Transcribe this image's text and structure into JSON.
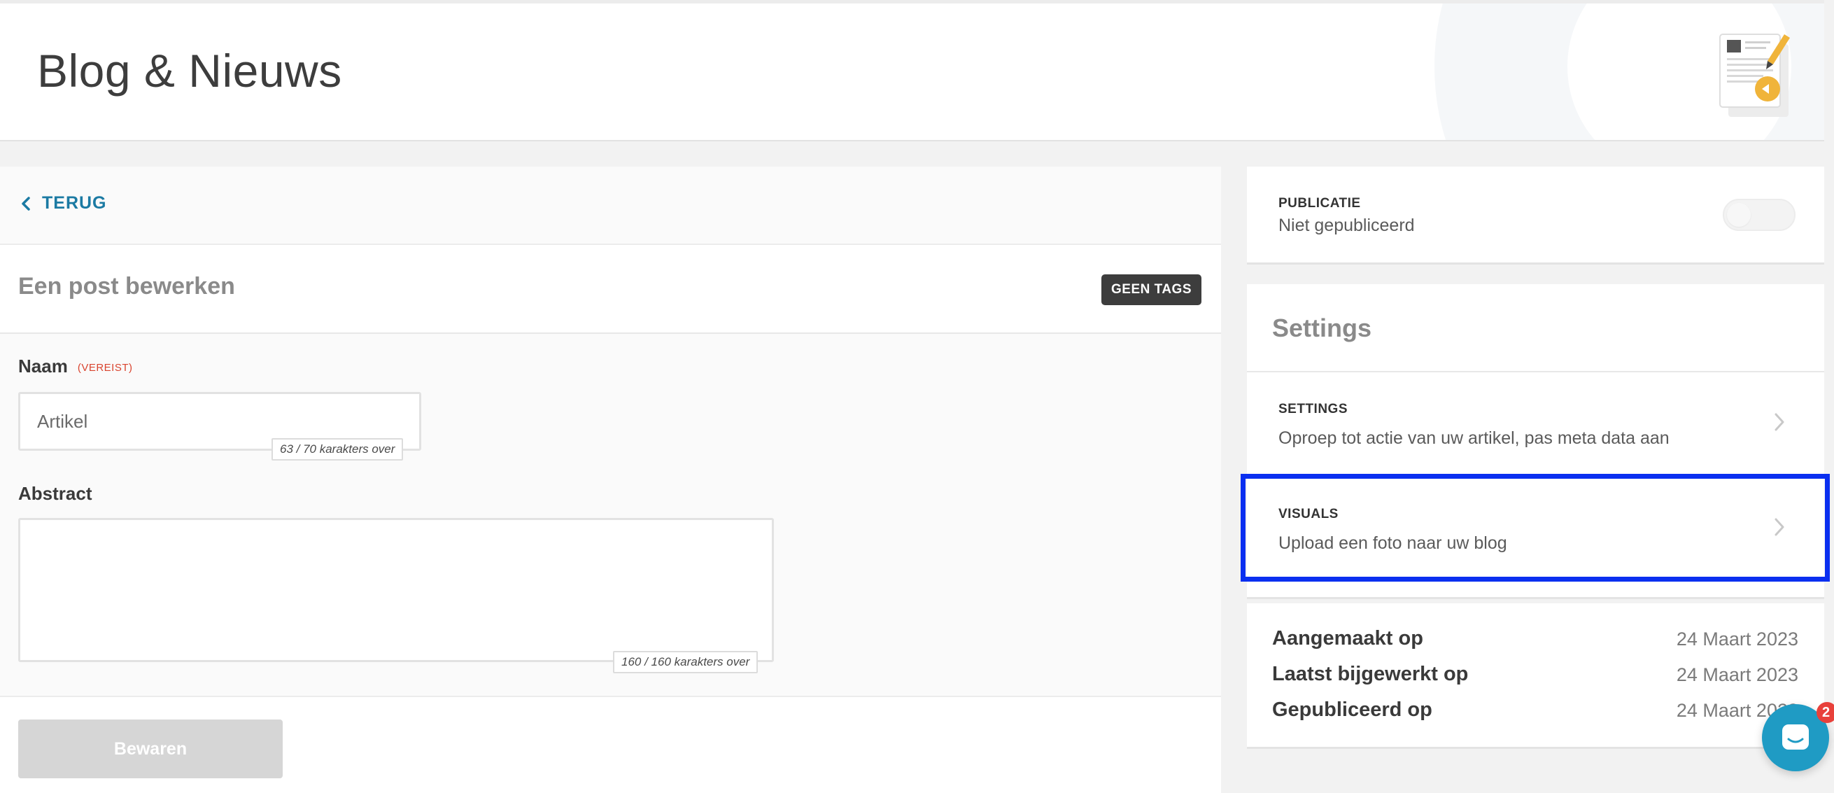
{
  "header": {
    "title": "Blog & Nieuws",
    "illustration_icon": "blog-document-pencil-icon"
  },
  "nav": {
    "back_label": "TERUG"
  },
  "editor": {
    "section_title": "Een post bewerken",
    "tags_button": "GEEN TAGS",
    "name_label": "Naam",
    "name_required": "(VEREIST)",
    "name_value": "Artikel",
    "name_counter": "63 / 70 karakters over",
    "abstract_label": "Abstract",
    "abstract_value": "",
    "abstract_counter": "160 / 160 karakters over",
    "save_label": "Bewaren"
  },
  "sidebar": {
    "publication": {
      "heading": "PUBLICATIE",
      "status": "Niet gepubliceerd",
      "published": false
    },
    "settings": {
      "title": "Settings",
      "items": [
        {
          "heading": "SETTINGS",
          "description": "Oproep tot actie van uw artikel, pas meta data aan"
        },
        {
          "heading": "VISUALS",
          "description": "Upload een foto naar uw blog"
        }
      ]
    },
    "dates": [
      {
        "label": "Aangemaakt op",
        "value": "24 Maart 2023"
      },
      {
        "label": "Laatst bijgewerkt op",
        "value": "24 Maart 2023"
      },
      {
        "label": "Gepubliceerd op",
        "value": "24 Maart 2023"
      }
    ]
  },
  "chat": {
    "badge_count": "2"
  },
  "colors": {
    "accent_link": "#1b7aa3",
    "highlight": "#0a2ff0",
    "chat": "#1f9bc4",
    "required": "#d9442f"
  }
}
